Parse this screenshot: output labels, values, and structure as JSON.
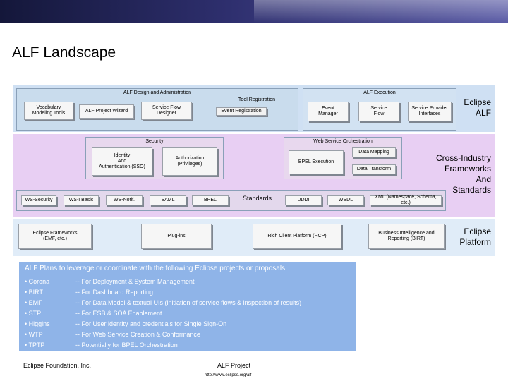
{
  "slide": {
    "title": "ALF Landscape"
  },
  "diagram": {
    "alf_band": {
      "label": "Eclipse\nALF",
      "design_admin": {
        "title": "ALF Design and Administration",
        "boxes": [
          "Vocabulary\nModeling Tools",
          "ALF Project Wizard",
          "Service Flow\nDesigner"
        ],
        "tool_registration": {
          "title": "Tool Registration",
          "event_registration": "Event Registration"
        }
      },
      "execution": {
        "title": "ALF Execution",
        "boxes": [
          "Event\nManager",
          "Service\nFlow",
          "Service Provider\nInterfaces"
        ]
      }
    },
    "cross_industry_band": {
      "label": "Cross-Industry\nFrameworks\nAnd\nStandards",
      "security": {
        "title": "Security",
        "boxes": [
          "Identity\nAnd\nAuthentication (SSO)",
          "Authorization\n(Privileges)"
        ]
      },
      "ws_orchestration": {
        "title": "Web Service Orchestration",
        "bpel_execution": "BPEL Execution",
        "data_mapping": "Data Mapping",
        "data_transform": "Data Transform"
      },
      "standards": {
        "label": "Standards",
        "boxes": [
          "WS-Security",
          "WS-I Basic",
          "WS-Notif.",
          "SAML",
          "BPEL",
          "UDDI",
          "WSDL",
          "XML (Namespace, Schema, etc.)"
        ]
      }
    },
    "eclipse_band": {
      "label": "Eclipse\nPlatform",
      "boxes": [
        "Eclipse Frameworks\n(EMF, etc.)",
        "Plug-ins",
        "Rich Client Platform (RCP)",
        "Business Intelligence and\nReporting (BIRT)"
      ]
    }
  },
  "plans": {
    "intro": "ALF Plans to leverage or coordinate with the following Eclipse projects or proposals:",
    "items": [
      {
        "name": "• Corona",
        "desc": "-- For Deployment & System Management"
      },
      {
        "name": "• BIRT",
        "desc": "-- For Dashboard Reporting"
      },
      {
        "name": "• EMF",
        "desc": "-- For Data Model & textual UIs (initiation of service flows & inspection of results)"
      },
      {
        "name": "• STP",
        "desc": "-- For ESB & SOA Enablement"
      },
      {
        "name": "• Higgins",
        "desc": "-- For User identity and credentials for Single Sign-On"
      },
      {
        "name": "• WTP",
        "desc": "-- For Web Service Creation & Conformance"
      },
      {
        "name": "• TPTP",
        "desc": "-- Potentially for BPEL Orchestration"
      }
    ]
  },
  "footer": {
    "left": "Eclipse Foundation, Inc.",
    "project": "ALF Project",
    "url": "http://www.eclipse.org/alf"
  },
  "colors": {
    "alf_band": "#cfe0f3",
    "cross_industry_band": "#e8cff3",
    "eclipse_band": "#e0ecf8",
    "plans_box": "#8fb4e8",
    "top_bar": "#2e2f6e"
  }
}
